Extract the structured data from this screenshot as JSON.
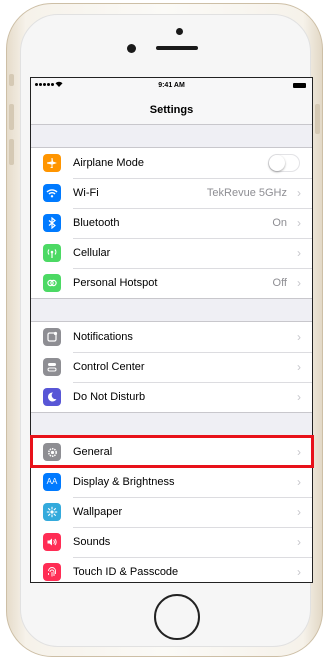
{
  "statusbar": {
    "time": "9:41 AM"
  },
  "navbar": {
    "title": "Settings"
  },
  "colors": {
    "airplane": "#ff9500",
    "wifi": "#007aff",
    "bluetooth": "#007aff",
    "cellular": "#4cd964",
    "hotspot": "#4cd964",
    "notifications": "#8e8e93",
    "control_center": "#8e8e93",
    "dnd": "#5856d6",
    "general": "#8e8e93",
    "display": "#007aff",
    "wallpaper": "#34aadc",
    "sounds": "#ff2d55",
    "touchid": "#ff2d55",
    "highlight": "#e8121a"
  },
  "group1": [
    {
      "label": "Airplane Mode",
      "icon": "airplane-icon",
      "toggle": "off"
    },
    {
      "label": "Wi-Fi",
      "icon": "wifi-icon",
      "value": "TekRevue 5GHz"
    },
    {
      "label": "Bluetooth",
      "icon": "bluetooth-icon",
      "value": "On"
    },
    {
      "label": "Cellular",
      "icon": "cellular-icon"
    },
    {
      "label": "Personal Hotspot",
      "icon": "hotspot-icon",
      "value": "Off"
    }
  ],
  "group2": [
    {
      "label": "Notifications",
      "icon": "notifications-icon"
    },
    {
      "label": "Control Center",
      "icon": "control-center-icon"
    },
    {
      "label": "Do Not Disturb",
      "icon": "moon-icon"
    }
  ],
  "group3": [
    {
      "label": "General",
      "icon": "gear-icon"
    },
    {
      "label": "Display & Brightness",
      "icon": "display-icon",
      "icon_text": "AA"
    },
    {
      "label": "Wallpaper",
      "icon": "wallpaper-icon"
    },
    {
      "label": "Sounds",
      "icon": "speaker-icon"
    },
    {
      "label": "Touch ID & Passcode",
      "icon": "fingerprint-icon"
    }
  ]
}
